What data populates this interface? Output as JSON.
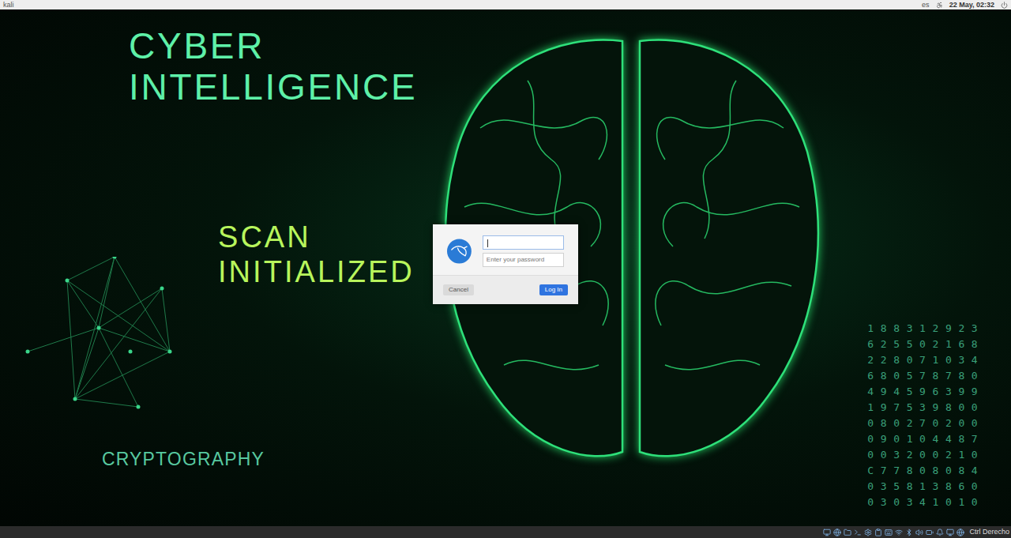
{
  "top_bar": {
    "host": "kali",
    "keyboard_layout": "es",
    "datetime": "22 May, 02:32"
  },
  "wallpaper": {
    "headings": [
      {
        "lines": [
          "CYBER",
          "INTELLIGENCE"
        ],
        "color": "#5ef0a8"
      },
      {
        "lines": [
          "SCAN",
          "INITIALIZED"
        ],
        "color": "#b8f55c"
      },
      {
        "lines": [
          "CRYPTOGRAPHY"
        ],
        "color": "#58c9a0"
      }
    ],
    "digits": [
      "188312923",
      "625502168",
      "228071034",
      "680578780",
      "494596399",
      "197539800",
      "080270200",
      "090104487",
      "003200210",
      "C77808084",
      "035813860",
      "030341010"
    ]
  },
  "login_dialog": {
    "username": {
      "value": "",
      "focused": true
    },
    "password": {
      "value": "",
      "placeholder": "Enter your password"
    },
    "buttons": [
      {
        "label": "Cancel",
        "kind": "secondary"
      },
      {
        "label": "Log In",
        "kind": "primary"
      }
    ]
  },
  "bottom_bar": {
    "key_indicator": "Ctrl Derecho"
  }
}
